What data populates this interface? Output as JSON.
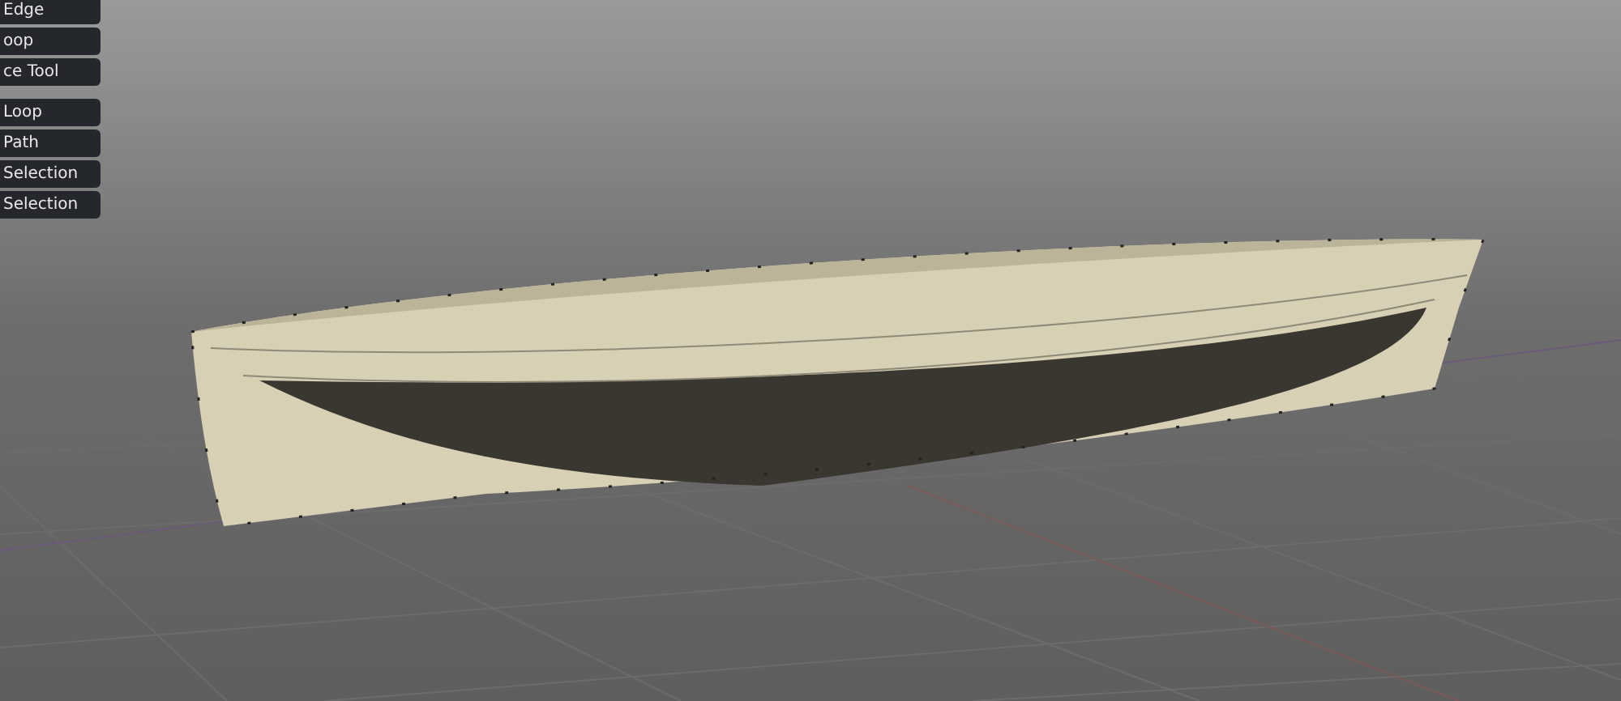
{
  "tool_panel": {
    "groups": [
      {
        "buttons": [
          "Edge",
          "oop",
          "ce Tool"
        ]
      },
      {
        "buttons": [
          "Loop",
          "Path",
          "Selection",
          "Selection"
        ]
      }
    ]
  }
}
